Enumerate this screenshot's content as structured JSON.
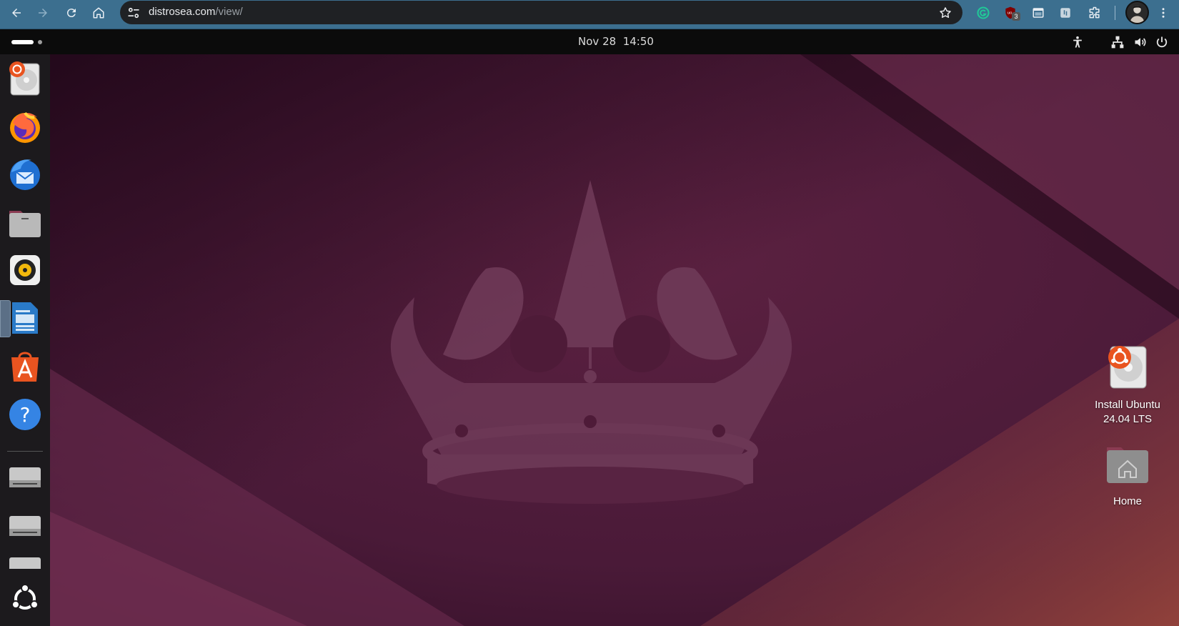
{
  "browser": {
    "url_host": "distrosea.com",
    "url_path": "/view/",
    "extension_badge": "3",
    "icons": [
      "back-icon",
      "forward-icon",
      "reload-icon",
      "home-icon",
      "site-info-icon",
      "bookmark-star-icon",
      "grammarly-icon",
      "ublock-icon",
      "tab-icon",
      "screenshot-icon",
      "extensions-icon",
      "profile-avatar",
      "menu-icon"
    ]
  },
  "panel": {
    "date": "Nov 28",
    "time": "14:50",
    "icons": [
      "accessibility-icon",
      "network-icon",
      "volume-icon",
      "power-icon"
    ]
  },
  "dock": {
    "apps": [
      "ubuntu-installer-icon",
      "firefox-icon",
      "thunderbird-icon",
      "files-icon",
      "rhythmbox-icon",
      "libreoffice-writer-icon",
      "app-center-icon",
      "help-icon",
      "drive-icon",
      "drive-icon",
      "drive-icon",
      "show-apps-icon"
    ]
  },
  "desktop": {
    "icons": [
      {
        "line1": "Install Ubuntu",
        "line2": "24.04 LTS"
      },
      {
        "line1": "Home"
      }
    ]
  },
  "colors": {
    "chrome_bar": "#3c6f8f",
    "omnibox": "#1f2124",
    "panel": "#0b0b0b",
    "dock": "#1c1a1d",
    "desktop_base": "#4e1b38",
    "ubuntu_orange": "#e95420"
  }
}
